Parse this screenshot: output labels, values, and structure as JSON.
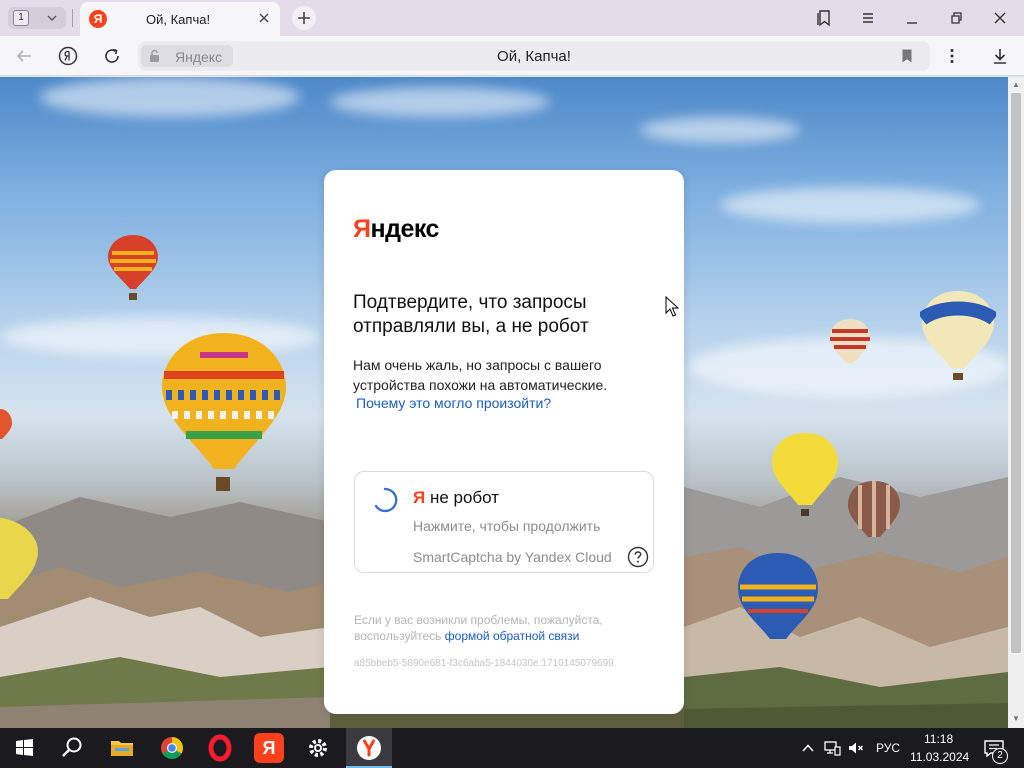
{
  "browser": {
    "tab_count": "1",
    "tab_title": "Ой, Капча!",
    "favicon_letter": "Я",
    "site_host": "Яндекс",
    "address_title": "Ой, Капча!"
  },
  "card": {
    "logo_ya": "Я",
    "logo_rest": "ндекс",
    "heading": "Подтвердите, что запросы отправляли вы, а не робот",
    "description": "Нам очень жаль, но запросы с вашего устройства похожи на автоматические.",
    "why_link": "Почему это могло произойти?",
    "captcha": {
      "ya": "Я",
      "label": " не робот",
      "hint": "Нажмите, чтобы продолжить",
      "provider": "SmartCaptcha by Yandex Cloud"
    },
    "problems_text": "Если у вас возникли проблемы, пожалуйста, воспользуйтесь ",
    "problems_link": "формой обратной связи",
    "request_id": "a85bbeb5-5890e681-f3c6aba5-1844030e:1710145079699"
  },
  "taskbar": {
    "language": "РУС",
    "time": "11:18",
    "date": "11.03.2024",
    "notifications": "2",
    "yandex_letter": "Я"
  },
  "colors": {
    "yandex_red": "#fc3f1d",
    "link_blue": "#1a5cbf",
    "taskbar_bg": "#1b1b1f"
  }
}
